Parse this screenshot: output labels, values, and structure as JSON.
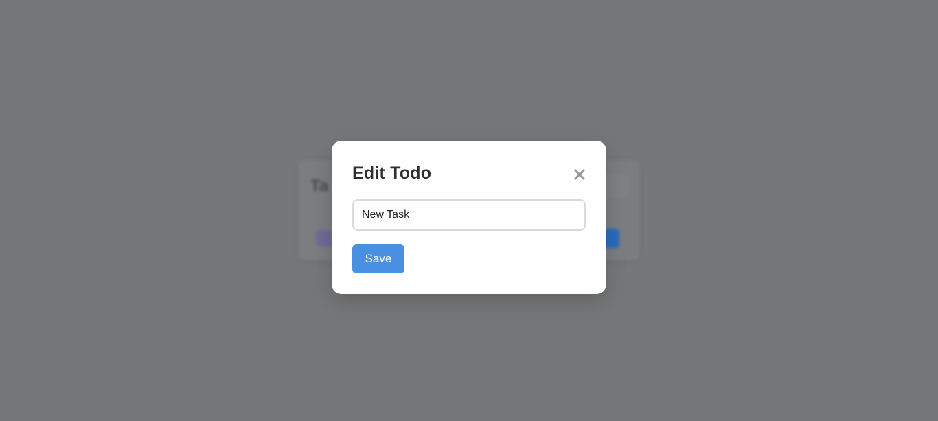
{
  "modal": {
    "title": "Edit Todo",
    "close_icon": "close-icon",
    "input_value": "New Task",
    "save_label": "Save"
  },
  "colors": {
    "overlay": "#757779",
    "modal_bg": "#ffffff",
    "primary": "#4a90e2",
    "title_text": "#2d2f33",
    "close_icon": "#9a9a9a",
    "input_border": "#dadada"
  }
}
